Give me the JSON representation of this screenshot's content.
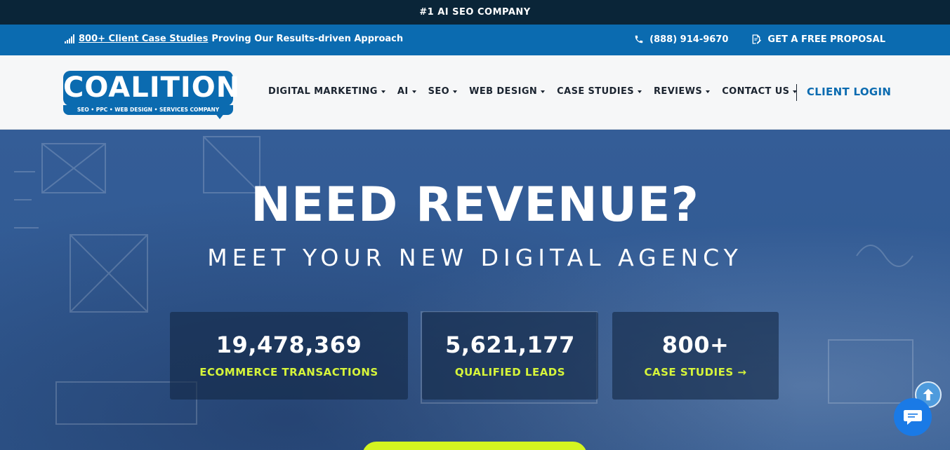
{
  "topbar": {
    "text": "#1 AI SEO COMPANY"
  },
  "infobar": {
    "case_link": "800+ Client Case Studies",
    "case_rest": "Proving Our Results-driven Approach",
    "phone": "(888) 914-9670",
    "proposal": "GET A FREE PROPOSAL"
  },
  "logo": {
    "word": "COALITION",
    "tagline": "SEO • PPC • WEB DESIGN • SERVICES COMPANY"
  },
  "nav": {
    "items": [
      {
        "label": "DIGITAL MARKETING"
      },
      {
        "label": "AI"
      },
      {
        "label": "SEO"
      },
      {
        "label": "WEB DESIGN"
      },
      {
        "label": "CASE STUDIES"
      },
      {
        "label": "REVIEWS"
      },
      {
        "label": "CONTACT US"
      }
    ],
    "login": "CLIENT LOGIN"
  },
  "hero": {
    "headline": "NEED REVENUE?",
    "subline": "MEET YOUR NEW DIGITAL AGENCY",
    "stats": [
      {
        "number": "19,478,369",
        "label": "ECOMMERCE TRANSACTIONS"
      },
      {
        "number": "5,621,177",
        "label": "QUALIFIED LEADS"
      },
      {
        "number": "800+",
        "label": "CASE STUDIES →"
      }
    ]
  },
  "colors": {
    "topbar": "#0a2538",
    "infobar": "#0b6bb0",
    "accent": "#d6f53a",
    "brand": "#0b6bb0"
  },
  "icons": {
    "signal": "signal-bars-icon",
    "phone": "phone-icon",
    "proposal": "document-edit-icon",
    "caret": "caret-down-icon",
    "scroll": "arrow-up-icon",
    "chat": "chat-bubble-icon"
  }
}
